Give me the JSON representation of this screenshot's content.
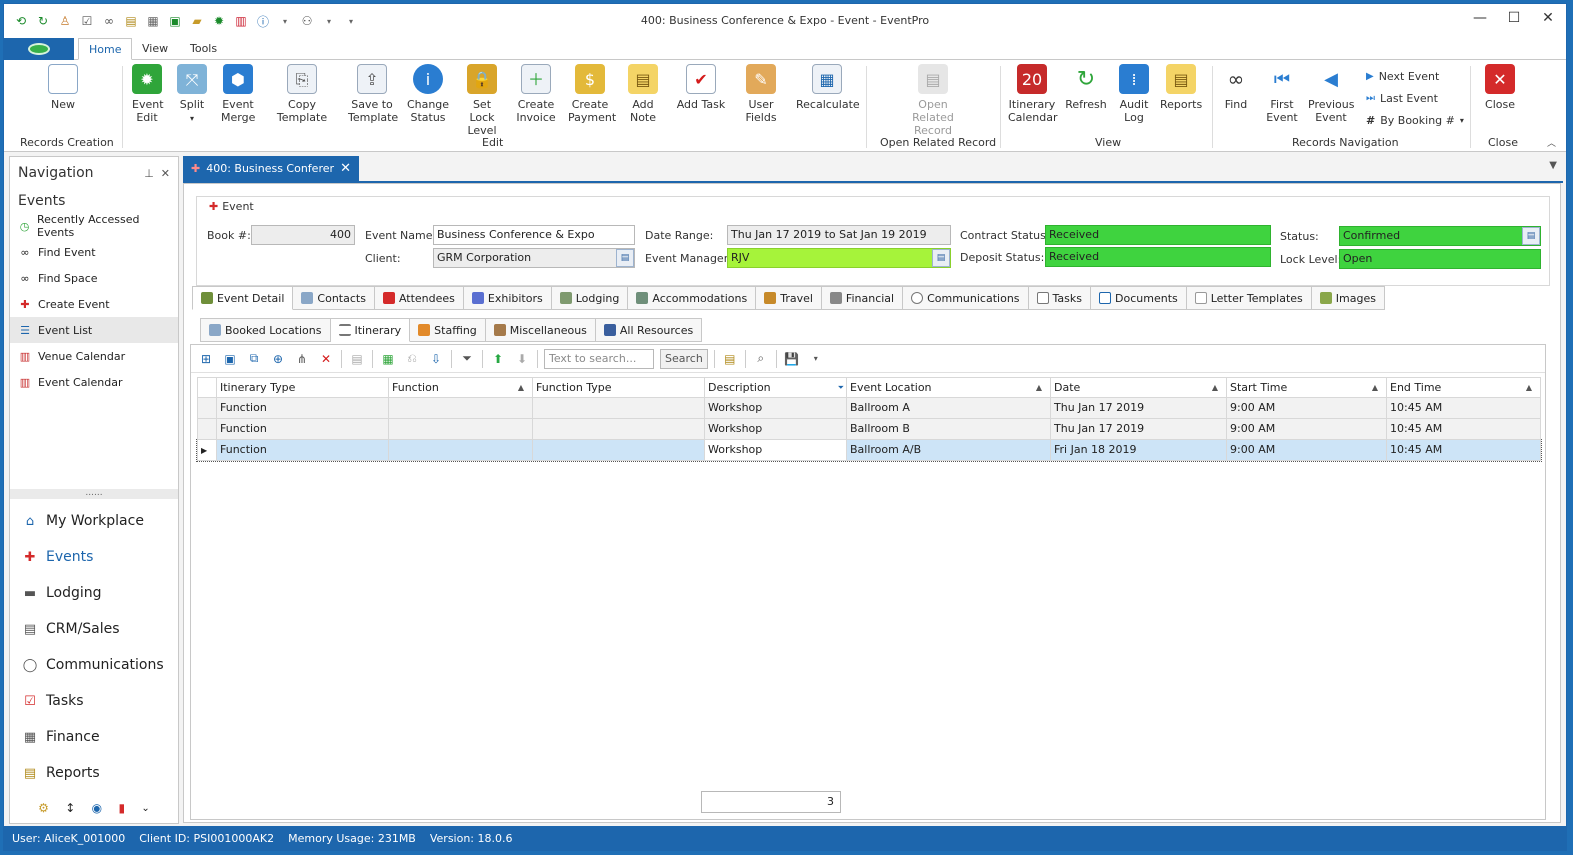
{
  "window": {
    "title": "400: Business Conference & Expo - Event - EventPro",
    "controls": {
      "minimize": "—",
      "maximize": "☐",
      "close": "✕"
    }
  },
  "ribbon": {
    "tabs": [
      "Home",
      "View",
      "Tools"
    ],
    "buttons": {
      "new": "New",
      "event_edit": "Event Edit",
      "split": "Split",
      "event_merge": "Event Merge",
      "copy_template": "Copy Template",
      "save_to_template": "Save to Template",
      "change_status": "Change Status",
      "set_lock_level": "Set Lock Level",
      "create_invoice": "Create Invoice",
      "create_payment": "Create Payment",
      "add_note": "Add Note",
      "add_task": "Add Task",
      "user_fields": "User Fields",
      "recalculate": "Recalculate",
      "open_related_record": "Open Related Record",
      "itinerary_calendar": "Itinerary Calendar",
      "refresh": "Refresh",
      "audit_log": "Audit Log",
      "reports": "Reports",
      "find": "Find",
      "first_event": "First Event",
      "previous_event": "Previous Event",
      "next_event": "Next Event",
      "last_event": "Last Event",
      "by_booking": "By Booking #",
      "close": "Close"
    },
    "groups": {
      "records_creation": "Records Creation",
      "edit": "Edit",
      "open_related_record": "Open Related Record",
      "view": "View",
      "records_navigation": "Records Navigation",
      "close": "Close"
    }
  },
  "navigation": {
    "title": "Navigation",
    "section": "Events",
    "items": [
      "Recently Accessed Events",
      "Find Event",
      "Find Space",
      "Create Event",
      "Event List",
      "Venue Calendar",
      "Event Calendar"
    ],
    "splitter": "......",
    "modules": [
      "My Workplace",
      "Events",
      "Lodging",
      "CRM/Sales",
      "Communications",
      "Tasks",
      "Finance",
      "Reports"
    ]
  },
  "doc_tab": {
    "label": "400: Business Conferer"
  },
  "event": {
    "section_title": "Event",
    "labels": {
      "book": "Book #:",
      "event_name": "Event Name:",
      "client": "Client:",
      "date_range": "Date Range:",
      "event_manager": "Event Manager:",
      "contract_status": "Contract Status:",
      "deposit_status": "Deposit Status:",
      "status": "Status:",
      "lock_level": "Lock Level:"
    },
    "values": {
      "book": "400",
      "event_name": "Business Conference & Expo",
      "client": "GRM Corporation",
      "date_range": "Thu Jan 17 2019 to Sat Jan 19 2019",
      "event_manager": "RJV",
      "contract_status": "Received",
      "deposit_status": "Received",
      "status": "Confirmed",
      "lock_level": "Open"
    }
  },
  "main_tabs": [
    "Event Detail",
    "Contacts",
    "Attendees",
    "Exhibitors",
    "Lodging",
    "Accommodations",
    "Travel",
    "Financial",
    "Communications",
    "Tasks",
    "Documents",
    "Letter Templates",
    "Images"
  ],
  "sub_tabs": [
    "Booked Locations",
    "Itinerary",
    "Staffing",
    "Miscellaneous",
    "All Resources"
  ],
  "search": {
    "placeholder": "Text to search...",
    "button": "Search"
  },
  "grid": {
    "columns": [
      "Itinerary Type",
      "Function",
      "Function Type",
      "Description",
      "Event Location",
      "Date",
      "Start Time",
      "End Time"
    ],
    "rows": [
      [
        "Function",
        "",
        "",
        "Workshop",
        "Ballroom A",
        "Thu Jan 17 2019",
        "9:00 AM",
        "10:45 AM"
      ],
      [
        "Function",
        "",
        "",
        "Workshop",
        "Ballroom B",
        "Thu Jan 17 2019",
        "9:00 AM",
        "10:45 AM"
      ],
      [
        "Function",
        "",
        "",
        "Workshop",
        "Ballroom A/B",
        "Fri Jan 18 2019",
        "9:00 AM",
        "10:45 AM"
      ]
    ],
    "row_count": "3"
  },
  "status_bar": {
    "user": "User: AliceK_001000",
    "client_id": "Client ID: PSI001000AK2",
    "memory": "Memory Usage: 231MB",
    "version": "Version: 18.0.6"
  },
  "colors": {
    "accent": "#1d66ad",
    "status_green": "#3fd33f",
    "manager_lime": "#a6f33a",
    "selected_row": "#cde4f7"
  }
}
